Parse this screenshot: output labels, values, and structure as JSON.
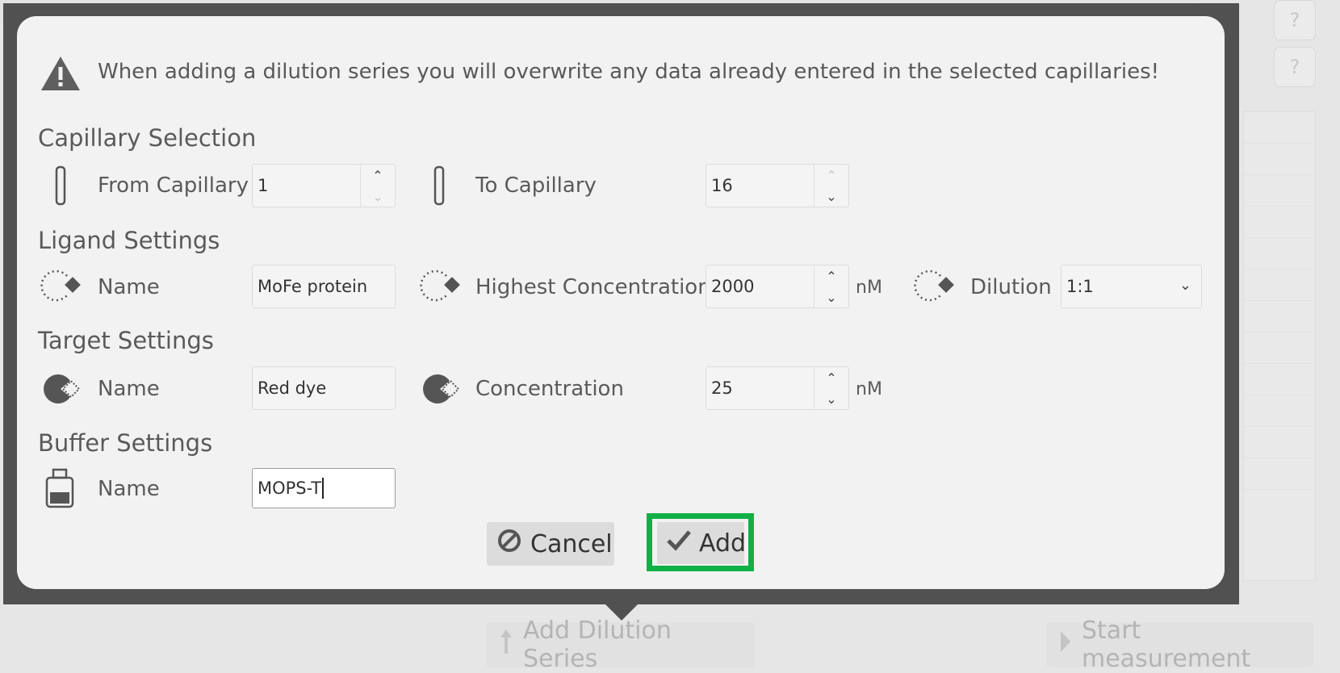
{
  "warning": {
    "text": "When adding a dilution series you will overwrite any data already entered in the selected capillaries!",
    "icon": "warning-triangle-icon"
  },
  "capillary": {
    "title": "Capillary Selection",
    "from_label": "From Capillary",
    "from_value": "1",
    "to_label": "To Capillary",
    "to_value": "16"
  },
  "ligand": {
    "title": "Ligand Settings",
    "name_label": "Name",
    "name_value": "MoFe protein",
    "conc_label": "Highest Concentration",
    "conc_value": "2000",
    "conc_unit": "nM",
    "dilution_label": "Dilution",
    "dilution_value": "1:1"
  },
  "target": {
    "title": "Target Settings",
    "name_label": "Name",
    "name_value": "Red dye",
    "conc_label": "Concentration",
    "conc_value": "25",
    "conc_unit": "nM"
  },
  "buffer": {
    "title": "Buffer Settings",
    "name_label": "Name",
    "name_value": "MOPS-T"
  },
  "buttons": {
    "cancel": "Cancel",
    "add": "Add"
  },
  "background": {
    "help_label": "?",
    "add_dilution_series": "Add Dilution Series",
    "start_measurement": "Start measurement"
  },
  "colors": {
    "highlight": "#11b046",
    "overlay": "#515151",
    "dialog": "#f2f2f2"
  }
}
